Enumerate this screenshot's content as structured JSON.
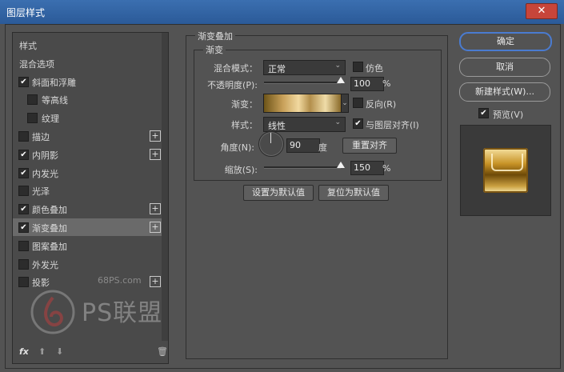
{
  "window": {
    "title": "图层样式",
    "close_glyph": "✕"
  },
  "sidebar": {
    "items": [
      {
        "label": "样式",
        "checkbox": false,
        "checked": false,
        "indent": 0,
        "plus": false,
        "selected": false
      },
      {
        "label": "混合选项",
        "checkbox": false,
        "checked": false,
        "indent": 0,
        "plus": false,
        "selected": false
      },
      {
        "label": "斜面和浮雕",
        "checkbox": true,
        "checked": true,
        "indent": 0,
        "plus": false,
        "selected": false
      },
      {
        "label": "等高线",
        "checkbox": true,
        "checked": false,
        "indent": 1,
        "plus": false,
        "selected": false
      },
      {
        "label": "纹理",
        "checkbox": true,
        "checked": false,
        "indent": 1,
        "plus": false,
        "selected": false
      },
      {
        "label": "描边",
        "checkbox": true,
        "checked": false,
        "indent": 0,
        "plus": true,
        "selected": false
      },
      {
        "label": "内阴影",
        "checkbox": true,
        "checked": true,
        "indent": 0,
        "plus": true,
        "selected": false
      },
      {
        "label": "内发光",
        "checkbox": true,
        "checked": true,
        "indent": 0,
        "plus": false,
        "selected": false
      },
      {
        "label": "光泽",
        "checkbox": true,
        "checked": false,
        "indent": 0,
        "plus": false,
        "selected": false
      },
      {
        "label": "颜色叠加",
        "checkbox": true,
        "checked": true,
        "indent": 0,
        "plus": true,
        "selected": false
      },
      {
        "label": "渐变叠加",
        "checkbox": true,
        "checked": true,
        "indent": 0,
        "plus": true,
        "selected": true
      },
      {
        "label": "图案叠加",
        "checkbox": true,
        "checked": false,
        "indent": 0,
        "plus": false,
        "selected": false
      },
      {
        "label": "外发光",
        "checkbox": true,
        "checked": false,
        "indent": 0,
        "plus": false,
        "selected": false
      },
      {
        "label": "投影",
        "checkbox": true,
        "checked": false,
        "indent": 0,
        "plus": true,
        "selected": false
      }
    ],
    "fx_label": "fx",
    "up_glyph": "⬆",
    "down_glyph": "⬇",
    "trash_glyph": "🗑"
  },
  "panel": {
    "title": "渐变叠加",
    "group_title": "渐变",
    "blend_mode_label": "混合模式：",
    "blend_mode_value": "正常",
    "dither_label": "仿色",
    "dither_checked": false,
    "opacity_label": "不透明度(P):",
    "opacity_value": "100",
    "opacity_fraction": 1.0,
    "percent": "%",
    "gradient_label": "渐变：",
    "reverse_label": "反向(R)",
    "reverse_checked": false,
    "style_label": "样式：",
    "style_value": "线性",
    "align_label": "与图层对齐(I)",
    "align_checked": true,
    "angle_label": "角度(N):",
    "angle_value": "90",
    "degree": "度",
    "reset_align_button": "重置对齐",
    "scale_label": "缩放(S):",
    "scale_value": "150",
    "scale_fraction": 1.0,
    "set_default_button": "设置为默认值",
    "reset_default_button": "复位为默认值",
    "chevron": "⌄"
  },
  "buttons": {
    "ok": "确定",
    "cancel": "取消",
    "new_style": "新建样式(W)...",
    "preview_label": "预览(V)",
    "preview_checked": true
  },
  "watermark": {
    "site": "68PS.com",
    "logo_text": "PS联盟"
  },
  "colors": {
    "accent": "#4a7bd0",
    "titlebar": "#2b5a98"
  }
}
